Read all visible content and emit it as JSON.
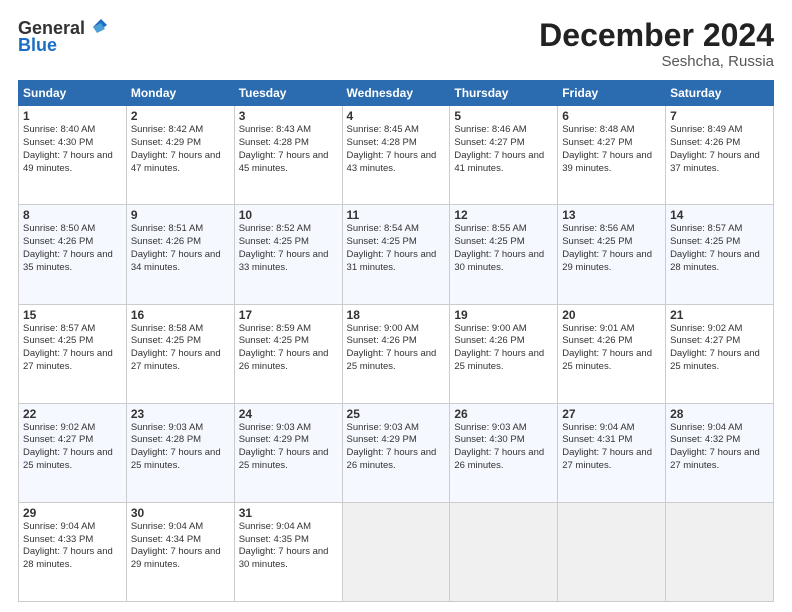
{
  "header": {
    "logo_line1": "General",
    "logo_line2": "Blue",
    "month_year": "December 2024",
    "location": "Seshcha, Russia"
  },
  "days_of_week": [
    "Sunday",
    "Monday",
    "Tuesday",
    "Wednesday",
    "Thursday",
    "Friday",
    "Saturday"
  ],
  "weeks": [
    [
      {
        "day": 1,
        "sunrise": "8:40 AM",
        "sunset": "4:30 PM",
        "daylight": "7 hours and 49 minutes."
      },
      {
        "day": 2,
        "sunrise": "8:42 AM",
        "sunset": "4:29 PM",
        "daylight": "7 hours and 47 minutes."
      },
      {
        "day": 3,
        "sunrise": "8:43 AM",
        "sunset": "4:28 PM",
        "daylight": "7 hours and 45 minutes."
      },
      {
        "day": 4,
        "sunrise": "8:45 AM",
        "sunset": "4:28 PM",
        "daylight": "7 hours and 43 minutes."
      },
      {
        "day": 5,
        "sunrise": "8:46 AM",
        "sunset": "4:27 PM",
        "daylight": "7 hours and 41 minutes."
      },
      {
        "day": 6,
        "sunrise": "8:48 AM",
        "sunset": "4:27 PM",
        "daylight": "7 hours and 39 minutes."
      },
      {
        "day": 7,
        "sunrise": "8:49 AM",
        "sunset": "4:26 PM",
        "daylight": "7 hours and 37 minutes."
      }
    ],
    [
      {
        "day": 8,
        "sunrise": "8:50 AM",
        "sunset": "4:26 PM",
        "daylight": "7 hours and 35 minutes."
      },
      {
        "day": 9,
        "sunrise": "8:51 AM",
        "sunset": "4:26 PM",
        "daylight": "7 hours and 34 minutes."
      },
      {
        "day": 10,
        "sunrise": "8:52 AM",
        "sunset": "4:25 PM",
        "daylight": "7 hours and 33 minutes."
      },
      {
        "day": 11,
        "sunrise": "8:54 AM",
        "sunset": "4:25 PM",
        "daylight": "7 hours and 31 minutes."
      },
      {
        "day": 12,
        "sunrise": "8:55 AM",
        "sunset": "4:25 PM",
        "daylight": "7 hours and 30 minutes."
      },
      {
        "day": 13,
        "sunrise": "8:56 AM",
        "sunset": "4:25 PM",
        "daylight": "7 hours and 29 minutes."
      },
      {
        "day": 14,
        "sunrise": "8:57 AM",
        "sunset": "4:25 PM",
        "daylight": "7 hours and 28 minutes."
      }
    ],
    [
      {
        "day": 15,
        "sunrise": "8:57 AM",
        "sunset": "4:25 PM",
        "daylight": "7 hours and 27 minutes."
      },
      {
        "day": 16,
        "sunrise": "8:58 AM",
        "sunset": "4:25 PM",
        "daylight": "7 hours and 27 minutes."
      },
      {
        "day": 17,
        "sunrise": "8:59 AM",
        "sunset": "4:25 PM",
        "daylight": "7 hours and 26 minutes."
      },
      {
        "day": 18,
        "sunrise": "9:00 AM",
        "sunset": "4:26 PM",
        "daylight": "7 hours and 25 minutes."
      },
      {
        "day": 19,
        "sunrise": "9:00 AM",
        "sunset": "4:26 PM",
        "daylight": "7 hours and 25 minutes."
      },
      {
        "day": 20,
        "sunrise": "9:01 AM",
        "sunset": "4:26 PM",
        "daylight": "7 hours and 25 minutes."
      },
      {
        "day": 21,
        "sunrise": "9:02 AM",
        "sunset": "4:27 PM",
        "daylight": "7 hours and 25 minutes."
      }
    ],
    [
      {
        "day": 22,
        "sunrise": "9:02 AM",
        "sunset": "4:27 PM",
        "daylight": "7 hours and 25 minutes."
      },
      {
        "day": 23,
        "sunrise": "9:03 AM",
        "sunset": "4:28 PM",
        "daylight": "7 hours and 25 minutes."
      },
      {
        "day": 24,
        "sunrise": "9:03 AM",
        "sunset": "4:29 PM",
        "daylight": "7 hours and 25 minutes."
      },
      {
        "day": 25,
        "sunrise": "9:03 AM",
        "sunset": "4:29 PM",
        "daylight": "7 hours and 26 minutes."
      },
      {
        "day": 26,
        "sunrise": "9:03 AM",
        "sunset": "4:30 PM",
        "daylight": "7 hours and 26 minutes."
      },
      {
        "day": 27,
        "sunrise": "9:04 AM",
        "sunset": "4:31 PM",
        "daylight": "7 hours and 27 minutes."
      },
      {
        "day": 28,
        "sunrise": "9:04 AM",
        "sunset": "4:32 PM",
        "daylight": "7 hours and 27 minutes."
      }
    ],
    [
      {
        "day": 29,
        "sunrise": "9:04 AM",
        "sunset": "4:33 PM",
        "daylight": "7 hours and 28 minutes."
      },
      {
        "day": 30,
        "sunrise": "9:04 AM",
        "sunset": "4:34 PM",
        "daylight": "7 hours and 29 minutes."
      },
      {
        "day": 31,
        "sunrise": "9:04 AM",
        "sunset": "4:35 PM",
        "daylight": "7 hours and 30 minutes."
      },
      null,
      null,
      null,
      null
    ]
  ]
}
